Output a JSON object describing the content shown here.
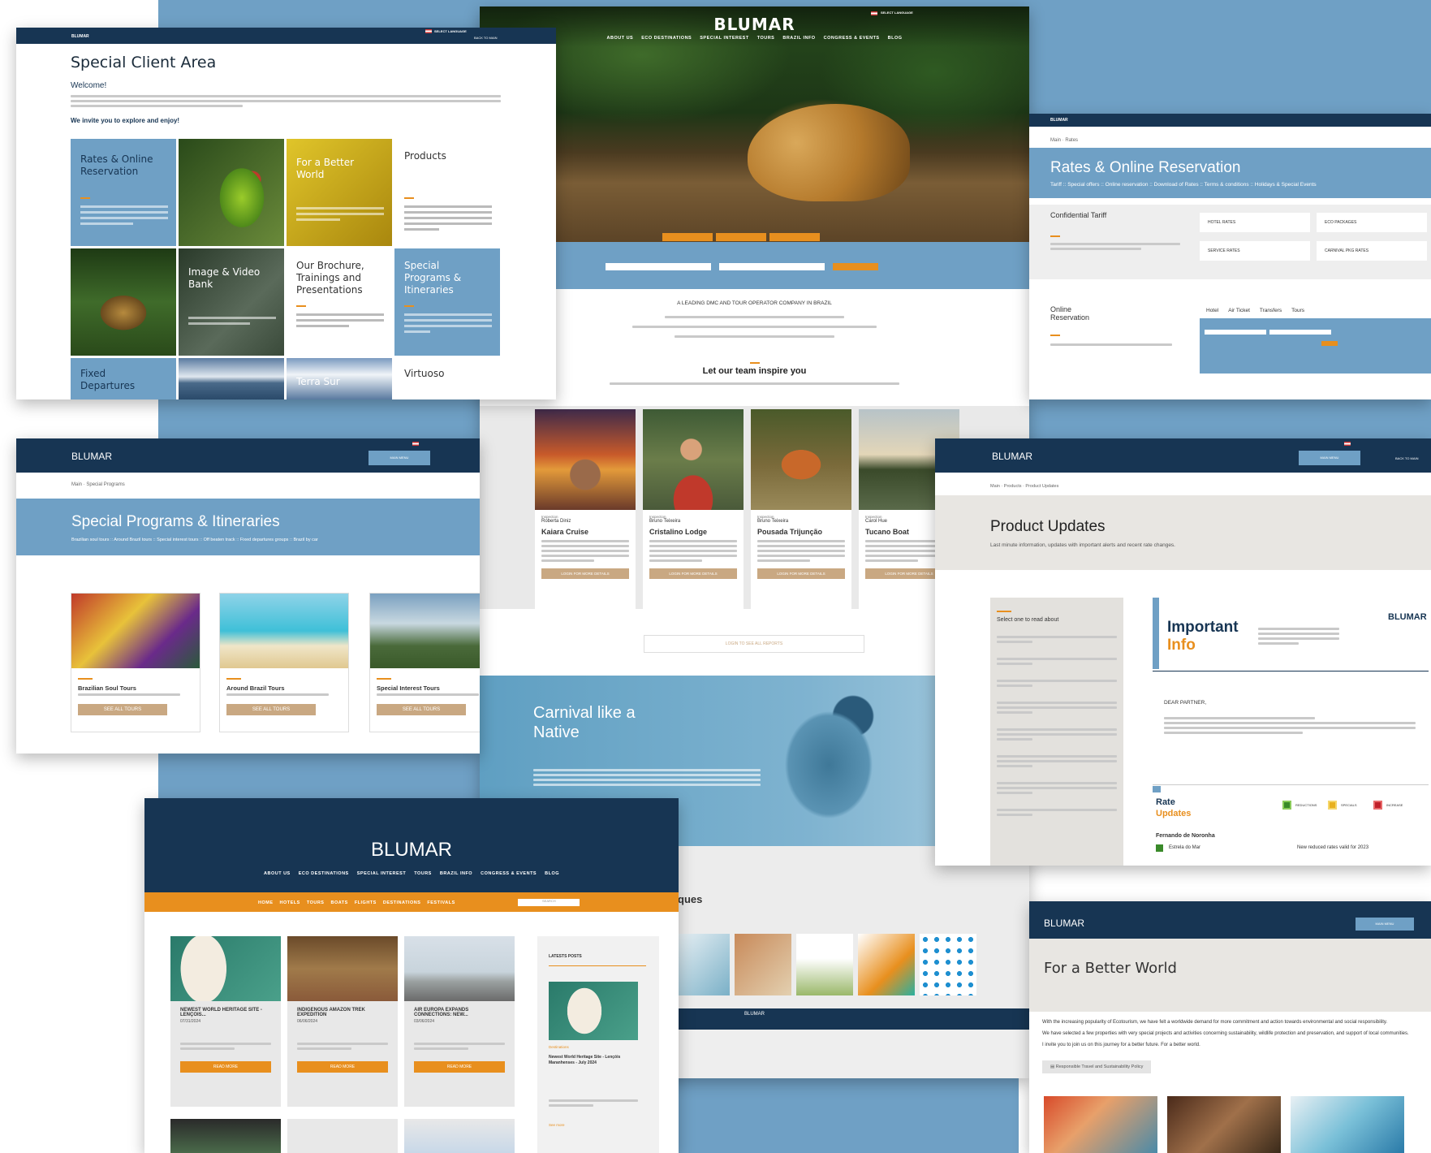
{
  "brand": "BLUMAR",
  "common": {
    "select_language": "SELECT LANGUAGE",
    "back_to_main": "BACK TO MAIN",
    "main_menu": "MAIN MENU"
  },
  "client_area": {
    "title": "Special Client Area",
    "welcome": "Welcome!",
    "invite": "We invite you to explore and enjoy!",
    "tiles": {
      "rates": "Rates & Online Reservation",
      "better_world": "For a Better World",
      "products": "Products",
      "image_bank": "Image & Video Bank",
      "brochure": "Our Brochure, Trainings and Presentations",
      "programs": "Special Programs & Itineraries",
      "fixed": "Fixed Departures",
      "terra": "Terra Sur",
      "virtuoso": "Virtuoso"
    }
  },
  "home": {
    "nav": [
      "ABOUT US",
      "ECO DESTINATIONS",
      "SPECIAL INTEREST",
      "TOURS",
      "BRAZIL INFO",
      "CONGRESS & EVENTS",
      "BLOG"
    ],
    "tagline": "A LEADING DMC AND TOUR OPERATOR COMPANY IN BRAZIL",
    "inspire_heading": "Let our team inspire you",
    "team": [
      {
        "role": "Inspection",
        "name": "Roberta Diniz",
        "title": "Kaiara Cruise"
      },
      {
        "role": "Inspection",
        "name": "Bruno Teixeira",
        "title": "Cristalino Lodge"
      },
      {
        "role": "Inspection",
        "name": "Bruno Teixeira",
        "title": "Pousada Trijunção"
      },
      {
        "role": "Inspection",
        "name": "Carol Hue",
        "title": "Tucano Boat"
      }
    ],
    "login_more": "LOGIN FOR MORE DETAILS",
    "login_all": "LOGIN TO SEE ALL REPORTS",
    "carnival_title": "Carnival like a Native",
    "ques_fragment": "ques"
  },
  "rates": {
    "crumb_main": "Main",
    "crumb_current": "Rates",
    "title": "Rates & Online Reservation",
    "subtitle": "Tariff :: Special offers :: Online reservation :: Download of Rates :: Terms & conditions :: Holidays & Special Events",
    "confidential": "Confidential Tariff",
    "buttons": [
      "HOTEL RATES",
      "ECO PACKAGES",
      "SERVICE RATES",
      "CARNIVAL PKG RATES"
    ],
    "online": "Online Reservation",
    "tabs": [
      "Hotel",
      "Air Ticket",
      "Transfers",
      "Tours"
    ]
  },
  "programs": {
    "crumb_main": "Main",
    "crumb_current": "Special Programs",
    "title": "Special Programs & Itineraries",
    "subtitle": "Brazilian soul tours :: Around Brazil tours :: Special interest tours :: Off beaten track :: Fixed departures groups :: Brazil by car",
    "cards": [
      {
        "title": "Brazilian Soul Tours"
      },
      {
        "title": "Around Brazil Tours"
      },
      {
        "title": "Special Interest Tours"
      }
    ],
    "see_all": "SEE ALL TOURS"
  },
  "updates": {
    "crumb": "Main · Products · Product Updates",
    "title": "Product Updates",
    "subtitle": "Last minute information, updates with important alerts and recent rate changes.",
    "select_read": "Select one to read about",
    "important": "Important",
    "info": "Info",
    "dear": "DEAR PARTNER,",
    "rate": "Rate",
    "updates_word": "Updates",
    "legend": [
      "REDUCTIONS",
      "SPECIALS",
      "INCREASE"
    ],
    "noronha": "Fernando de Noronha",
    "estrela": "Estrela do Mar",
    "new_rates": "New reduced rates valid for 2023"
  },
  "blog": {
    "subnav": [
      "HOME",
      "HOTELS",
      "TOURS",
      "BOATS",
      "FLIGHTS",
      "DESTINATIONS",
      "FESTIVALS"
    ],
    "search": "SEARCH",
    "posts": [
      {
        "title": "NEWEST WORLD HERITAGE SITE - LENÇOIS...",
        "date": "07/31/2024"
      },
      {
        "title": "INDIGENOUS AMAZON TREK EXPEDITION",
        "date": "06/06/2024"
      },
      {
        "title": "AIR EUROPA EXPANDS CONNECTIONS: NEW...",
        "date": "03/06/2024"
      }
    ],
    "read_more": "READ MORE",
    "latest": "LATESTS POSTS",
    "side_cat": "Destinations",
    "side_title": "Newest World Heritage Site - Lençóis Maranhenses - July 2024",
    "see_more": "See more"
  },
  "better": {
    "title": "For a Better World",
    "line1": "With the increasing popularity of Ecotourism, we have felt a worldwide demand for more commitment and action towards environmental and social responsibility.",
    "line2": "We have selected a few properties with very special projects and activities concerning sustainability, wildlife protection and preservation, and support of local communities.",
    "line3": "I invite you to join us on this journey for a better future. For a better world.",
    "policy": "Responsible Travel and Sustainability Policy"
  },
  "colors": {
    "navy": "#173553",
    "blue": "#6fa0c5",
    "orange": "#e88f1e",
    "tan": "#c9a882"
  }
}
